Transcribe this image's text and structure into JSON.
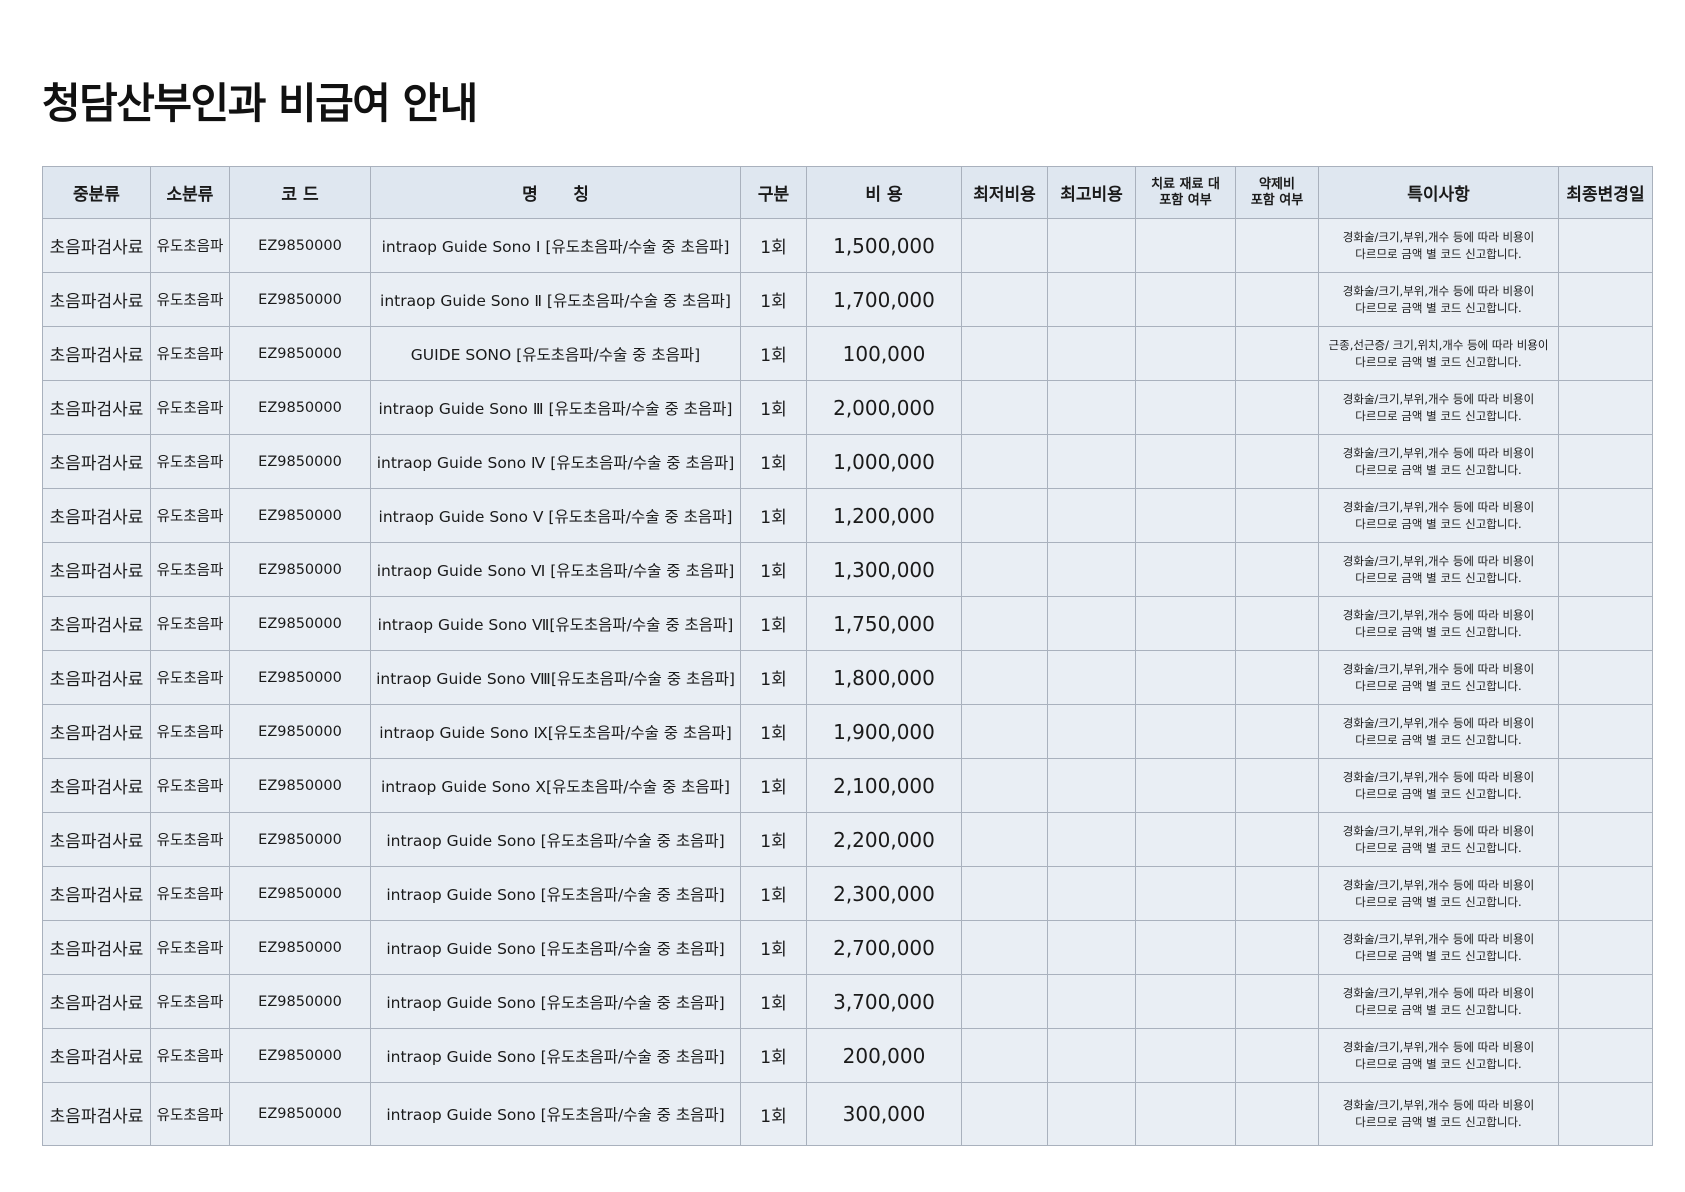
{
  "title": "청담산부인과 비급여 안내",
  "headers": {
    "mid": "중분류",
    "sub": "소분류",
    "code": "코 드",
    "name": "명      칭",
    "unit": "구분",
    "cost": "비 용",
    "min": "최저비용",
    "max": "최고비용",
    "material_l1": "치료 재료 대",
    "material_l2": "포함 여부",
    "drug_l1": "약제비",
    "drug_l2": "포함 여부",
    "note": "특이사항",
    "updated": "최종변경일"
  },
  "rows": [
    {
      "mid": "초음파검사료",
      "sub": "유도초음파",
      "code": "EZ9850000",
      "name": "intraop Guide Sono Ⅰ [유도초음파/수술 중 초음파]",
      "unit": "1회",
      "cost": "1,500,000",
      "min": "",
      "max": "",
      "material": "",
      "drug": "",
      "note1": "경화술/크기,부위,개수 등에 따라 비용이",
      "note2": "다르므로 금액 별 코드 신고합니다.",
      "updated": ""
    },
    {
      "mid": "초음파검사료",
      "sub": "유도초음파",
      "code": "EZ9850000",
      "name": "intraop Guide Sono Ⅱ [유도초음파/수술 중 초음파]",
      "unit": "1회",
      "cost": "1,700,000",
      "min": "",
      "max": "",
      "material": "",
      "drug": "",
      "note1": "경화술/크기,부위,개수 등에 따라 비용이",
      "note2": "다르므로 금액 별 코드 신고합니다.",
      "updated": ""
    },
    {
      "mid": "초음파검사료",
      "sub": "유도초음파",
      "code": "EZ9850000",
      "name": "GUIDE SONO [유도초음파/수술 중 초음파]",
      "unit": "1회",
      "cost": "100,000",
      "min": "",
      "max": "",
      "material": "",
      "drug": "",
      "note1": "근종,선근증/ 크기,위치,개수 등에 따라 비용이",
      "note2": "다르므로 금액 별 코드 신고합니다.",
      "updated": ""
    },
    {
      "mid": "초음파검사료",
      "sub": "유도초음파",
      "code": "EZ9850000",
      "name": "intraop Guide Sono Ⅲ [유도초음파/수술 중 초음파]",
      "unit": "1회",
      "cost": "2,000,000",
      "min": "",
      "max": "",
      "material": "",
      "drug": "",
      "note1": "경화술/크기,부위,개수 등에 따라 비용이",
      "note2": "다르므로 금액 별 코드 신고합니다.",
      "updated": ""
    },
    {
      "mid": "초음파검사료",
      "sub": "유도초음파",
      "code": "EZ9850000",
      "name": "intraop Guide Sono Ⅳ [유도초음파/수술 중 초음파]",
      "unit": "1회",
      "cost": "1,000,000",
      "min": "",
      "max": "",
      "material": "",
      "drug": "",
      "note1": "경화술/크기,부위,개수 등에 따라 비용이",
      "note2": "다르므로 금액 별 코드 신고합니다.",
      "updated": ""
    },
    {
      "mid": "초음파검사료",
      "sub": "유도초음파",
      "code": "EZ9850000",
      "name": "intraop Guide Sono Ⅴ [유도초음파/수술 중 초음파]",
      "unit": "1회",
      "cost": "1,200,000",
      "min": "",
      "max": "",
      "material": "",
      "drug": "",
      "note1": "경화술/크기,부위,개수 등에 따라 비용이",
      "note2": "다르므로 금액 별 코드 신고합니다.",
      "updated": ""
    },
    {
      "mid": "초음파검사료",
      "sub": "유도초음파",
      "code": "EZ9850000",
      "name": "intraop Guide Sono Ⅵ [유도초음파/수술 중 초음파]",
      "unit": "1회",
      "cost": "1,300,000",
      "min": "",
      "max": "",
      "material": "",
      "drug": "",
      "note1": "경화술/크기,부위,개수 등에 따라 비용이",
      "note2": "다르므로 금액 별 코드 신고합니다.",
      "updated": ""
    },
    {
      "mid": "초음파검사료",
      "sub": "유도초음파",
      "code": "EZ9850000",
      "name": "intraop Guide Sono Ⅶ[유도초음파/수술 중 초음파]",
      "unit": "1회",
      "cost": "1,750,000",
      "min": "",
      "max": "",
      "material": "",
      "drug": "",
      "note1": "경화술/크기,부위,개수 등에 따라 비용이",
      "note2": "다르므로 금액 별 코드 신고합니다.",
      "updated": ""
    },
    {
      "mid": "초음파검사료",
      "sub": "유도초음파",
      "code": "EZ9850000",
      "name": "intraop Guide Sono Ⅷ[유도초음파/수술 중 초음파]",
      "unit": "1회",
      "cost": "1,800,000",
      "min": "",
      "max": "",
      "material": "",
      "drug": "",
      "note1": "경화술/크기,부위,개수 등에 따라 비용이",
      "note2": "다르므로 금액 별 코드 신고합니다.",
      "updated": ""
    },
    {
      "mid": "초음파검사료",
      "sub": "유도초음파",
      "code": "EZ9850000",
      "name": "intraop Guide Sono Ⅸ[유도초음파/수술 중 초음파]",
      "unit": "1회",
      "cost": "1,900,000",
      "min": "",
      "max": "",
      "material": "",
      "drug": "",
      "note1": "경화술/크기,부위,개수 등에 따라 비용이",
      "note2": "다르므로 금액 별 코드 신고합니다.",
      "updated": ""
    },
    {
      "mid": "초음파검사료",
      "sub": "유도초음파",
      "code": "EZ9850000",
      "name": "intraop Guide Sono Ⅹ[유도초음파/수술 중 초음파]",
      "unit": "1회",
      "cost": "2,100,000",
      "min": "",
      "max": "",
      "material": "",
      "drug": "",
      "note1": "경화술/크기,부위,개수 등에 따라 비용이",
      "note2": "다르므로 금액 별 코드 신고합니다.",
      "updated": ""
    },
    {
      "mid": "초음파검사료",
      "sub": "유도초음파",
      "code": "EZ9850000",
      "name": "intraop Guide Sono [유도초음파/수술 중 초음파]",
      "unit": "1회",
      "cost": "2,200,000",
      "min": "",
      "max": "",
      "material": "",
      "drug": "",
      "note1": "경화술/크기,부위,개수 등에 따라 비용이",
      "note2": "다르므로 금액 별 코드 신고합니다.",
      "updated": ""
    },
    {
      "mid": "초음파검사료",
      "sub": "유도초음파",
      "code": "EZ9850000",
      "name": "intraop Guide Sono [유도초음파/수술 중 초음파]",
      "unit": "1회",
      "cost": "2,300,000",
      "min": "",
      "max": "",
      "material": "",
      "drug": "",
      "note1": "경화술/크기,부위,개수 등에 따라 비용이",
      "note2": "다르므로 금액 별 코드 신고합니다.",
      "updated": ""
    },
    {
      "mid": "초음파검사료",
      "sub": "유도초음파",
      "code": "EZ9850000",
      "name": "intraop Guide Sono [유도초음파/수술 중 초음파]",
      "unit": "1회",
      "cost": "2,700,000",
      "min": "",
      "max": "",
      "material": "",
      "drug": "",
      "note1": "경화술/크기,부위,개수 등에 따라 비용이",
      "note2": "다르므로 금액 별 코드 신고합니다.",
      "updated": ""
    },
    {
      "mid": "초음파검사료",
      "sub": "유도초음파",
      "code": "EZ9850000",
      "name": "intraop Guide Sono [유도초음파/수술 중 초음파]",
      "unit": "1회",
      "cost": "3,700,000",
      "min": "",
      "max": "",
      "material": "",
      "drug": "",
      "note1": "경화술/크기,부위,개수 등에 따라 비용이",
      "note2": "다르므로 금액 별 코드 신고합니다.",
      "updated": ""
    },
    {
      "mid": "초음파검사료",
      "sub": "유도초음파",
      "code": "EZ9850000",
      "name": "intraop Guide Sono [유도초음파/수술 중 초음파]",
      "unit": "1회",
      "cost": "200,000",
      "min": "",
      "max": "",
      "material": "",
      "drug": "",
      "note1": "경화술/크기,부위,개수 등에 따라 비용이",
      "note2": "다르므로 금액 별 코드 신고합니다.",
      "updated": ""
    },
    {
      "mid": "초음파검사료",
      "sub": "유도초음파",
      "code": "EZ9850000",
      "name": "intraop Guide Sono [유도초음파/수술 중 초음파]",
      "unit": "1회",
      "cost": "300,000",
      "min": "",
      "max": "",
      "material": "",
      "drug": "",
      "note1": "경화술/크기,부위,개수 등에 따라 비용이",
      "note2": "다르므로 금액 별 코드 신고합니다.",
      "updated": ""
    }
  ]
}
